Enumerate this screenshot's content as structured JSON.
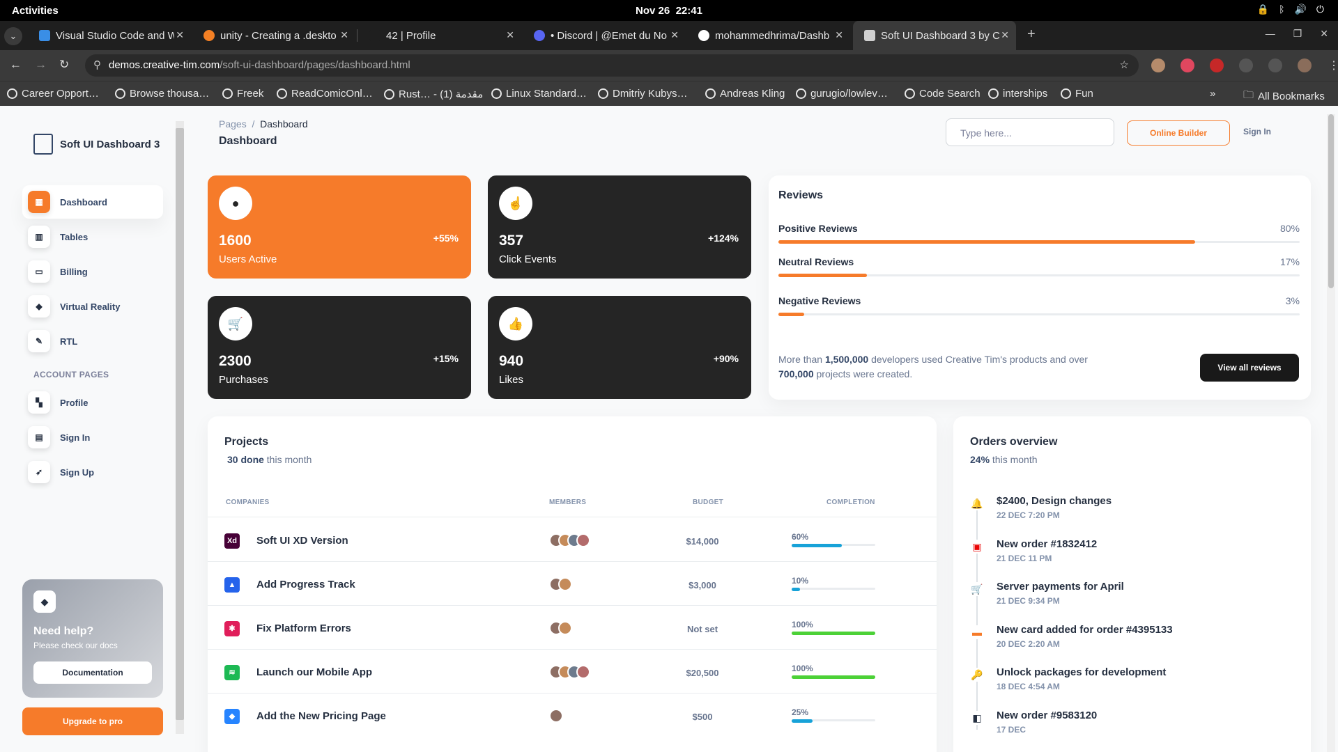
{
  "os": {
    "activities": "Activities",
    "date": "Nov 26",
    "time": "22:41"
  },
  "tabs": [
    {
      "title": "Visual Studio Code and W",
      "color": "#3a8ee6"
    },
    {
      "title": "unity - Creating a .deskto",
      "color": "#f48024"
    },
    {
      "title": "42 | Profile",
      "color": "#1f1f1f"
    },
    {
      "title": "• Discord | @Emet du No",
      "color": "#5865f2"
    },
    {
      "title": "mohammedhrima/Dashb",
      "color": "#ffffff"
    },
    {
      "title": "Soft UI Dashboard 3 by C",
      "color": "#d0d0d0"
    }
  ],
  "address": {
    "host": "demos.creative-tim.com",
    "path": "/soft-ui-dashboard/pages/dashboard.html"
  },
  "bookmarks": [
    "Career Opport…",
    "Browse thousa…",
    "Freek",
    "ReadComicOnl…",
    "Rust… - مقدمة (1)",
    "Linux Standard…",
    "Dmitriy Kubys…",
    "Andreas Kling",
    "gurugio/lowlev…",
    "Code Search",
    "interships",
    "Fun"
  ],
  "bookmarks_all": "All Bookmarks",
  "sidebar": {
    "brand": "Soft UI Dashboard 3",
    "items": [
      {
        "label": "Dashboard",
        "icon": "▦"
      },
      {
        "label": "Tables",
        "icon": "▥"
      },
      {
        "label": "Billing",
        "icon": "▭"
      },
      {
        "label": "Virtual Reality",
        "icon": "◆"
      },
      {
        "label": "RTL",
        "icon": "✎"
      }
    ],
    "section": "ACCOUNT PAGES",
    "account_items": [
      {
        "label": "Profile",
        "icon": "▚"
      },
      {
        "label": "Sign In",
        "icon": "▤"
      },
      {
        "label": "Sign Up",
        "icon": "➶"
      }
    ],
    "help_title": "Need help?",
    "help_sub": "Please check our docs",
    "help_button": "Documentation",
    "upgrade": "Upgrade to pro"
  },
  "header": {
    "crumb_root": "Pages",
    "crumb_sep": "/",
    "crumb_current": "Dashboard",
    "title": "Dashboard",
    "search_placeholder": "Type here...",
    "online_builder": "Online Builder",
    "sign_in": "Sign In"
  },
  "stats": [
    {
      "value": "1600",
      "label": "Users Active",
      "change": "+55%",
      "icon": "●"
    },
    {
      "value": "357",
      "label": "Click Events",
      "change": "+124%",
      "icon": "☝"
    },
    {
      "value": "2300",
      "label": "Purchases",
      "change": "+15%",
      "icon": "🛒"
    },
    {
      "value": "940",
      "label": "Likes",
      "change": "+90%",
      "icon": "👍"
    }
  ],
  "reviews": {
    "title": "Reviews",
    "rows": [
      {
        "name": "Positive Reviews",
        "pct": "80%",
        "value": 0.8
      },
      {
        "name": "Neutral Reviews",
        "pct": "17%",
        "value": 0.17
      },
      {
        "name": "Negative Reviews",
        "pct": "3%",
        "value": 0.05
      }
    ],
    "note_a": "More than ",
    "note_b": "1,500,000",
    "note_c": " developers used Creative Tim's products and over ",
    "note_d": "700,000",
    "note_e": " projects were created.",
    "button": "View all reviews"
  },
  "projects": {
    "title": "Projects",
    "done": "30 done",
    "done_suffix": " this month",
    "headers": [
      "COMPANIES",
      "MEMBERS",
      "BUDGET",
      "COMPLETION"
    ],
    "rows": [
      {
        "name": "Soft UI XD Version",
        "logo": "Xd",
        "logo_color": "#470137",
        "members": 4,
        "budget": "$14,000",
        "completion": "60%",
        "value": 0.6,
        "bar_color": "#17a2d8"
      },
      {
        "name": "Add Progress Track",
        "logo": "▲",
        "logo_color": "#2563eb",
        "members": 2,
        "budget": "$3,000",
        "completion": "10%",
        "value": 0.1,
        "bar_color": "#17a2d8"
      },
      {
        "name": "Fix Platform Errors",
        "logo": "✱",
        "logo_color": "#e01e5a",
        "members": 2,
        "budget": "Not set",
        "completion": "100%",
        "value": 1.0,
        "bar_color": "#4cd137"
      },
      {
        "name": "Launch our Mobile App",
        "logo": "≋",
        "logo_color": "#1db954",
        "members": 4,
        "budget": "$20,500",
        "completion": "100%",
        "value": 1.0,
        "bar_color": "#4cd137"
      },
      {
        "name": "Add the New Pricing Page",
        "logo": "◆",
        "logo_color": "#2684ff",
        "members": 1,
        "budget": "$500",
        "completion": "25%",
        "value": 0.25,
        "bar_color": "#17a2d8"
      }
    ]
  },
  "orders": {
    "title": "Orders overview",
    "pct": "24%",
    "suffix": " this month",
    "items": [
      {
        "title": "$2400, Design changes",
        "date": "22 DEC 7:20 PM",
        "icon": "🔔",
        "color": "#4cd137"
      },
      {
        "title": "New order #1832412",
        "date": "21 DEC 11 PM",
        "icon": "▣",
        "color": "#ea0606"
      },
      {
        "title": "Server payments for April",
        "date": "21 DEC 9:34 PM",
        "icon": "🛒",
        "color": "#17a2d8"
      },
      {
        "title": "New card added for order #4395133",
        "date": "20 DEC 2:20 AM",
        "icon": "▬",
        "color": "#f67b2a"
      },
      {
        "title": "Unlock packages for development",
        "date": "18 DEC 4:54 AM",
        "icon": "🔑",
        "color": "#f67b2a"
      },
      {
        "title": "New order #9583120",
        "date": "17 DEC",
        "icon": "◧",
        "color": "#252f40"
      }
    ]
  }
}
